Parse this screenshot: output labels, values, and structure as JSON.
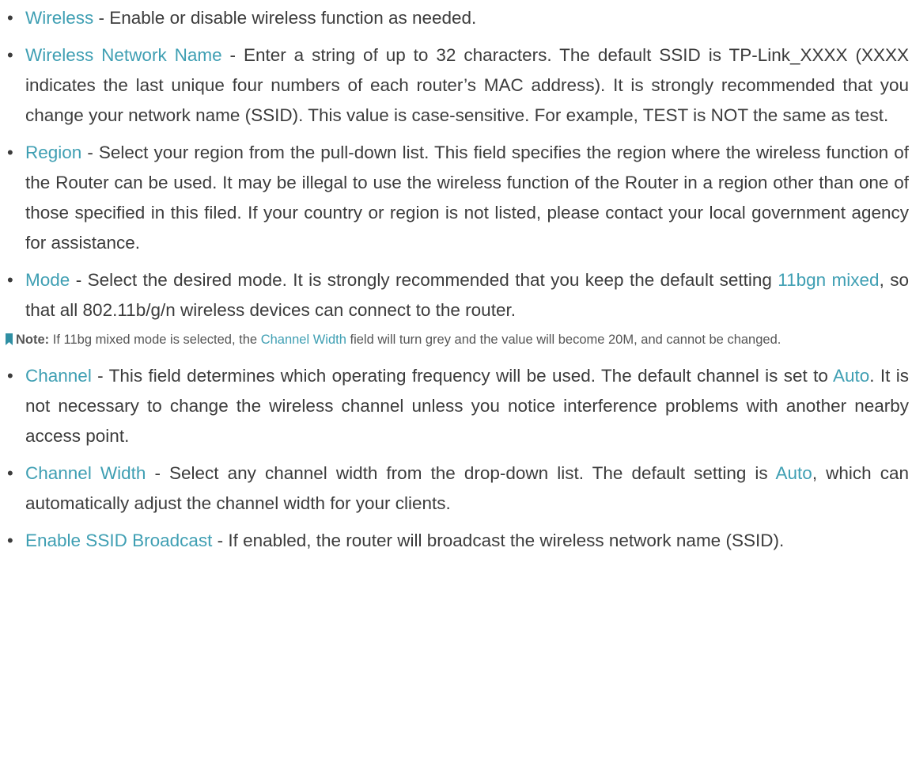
{
  "items_before_note": [
    {
      "term": "Wireless",
      "text": " - Enable or disable wireless function as needed."
    },
    {
      "term": "Wireless Network Name",
      "text": " - Enter a string of up to 32 characters. The default SSID is TP-Link_XXXX (XXXX indicates the last unique four numbers of each router’s MAC address). It is strongly recommended that you change your network name (SSID). This value is case-sensitive. For example, TEST is NOT the same as test."
    },
    {
      "term": "Region",
      "text": " - Select your region from the pull-down list. This field specifies the region where the wireless function of the Router can be used. It may be illegal to use the wireless function of the Router in a region other than one of those specified in this filed. If your country or region is not listed, please contact your local government agency for assistance."
    },
    {
      "term": "Mode",
      "text_a": " - Select the desired mode. It is strongly recommended that you keep the default setting ",
      "highlight": "11bgn mixed",
      "text_b": ", so that all 802.11b/g/n wireless devices can connect to the router."
    }
  ],
  "note": {
    "label": "Note:",
    "text_a": " If 11bg mixed mode is selected, the ",
    "highlight": "Channel Width",
    "text_b": " field will turn grey and the value will become 20M, and cannot be changed.",
    "icon": "note-flag-icon"
  },
  "items_after_note": [
    {
      "term": "Channel",
      "text_a": " - This field determines which operating frequency will be used. The default channel is set to ",
      "highlight": "Auto",
      "text_b": ". It is not necessary to change the wireless channel unless you notice interference problems with another nearby access point."
    },
    {
      "term": "Channel Width",
      "text_a": " - Select any channel width from the drop-down list. The default setting is ",
      "highlight": "Auto",
      "text_b": ", which can automatically adjust the channel width for your clients."
    },
    {
      "term": "Enable SSID Broadcast",
      "text": " - If enabled, the router will broadcast the wireless network name (SSID)."
    }
  ],
  "colors": {
    "accent": "#3f9fb3",
    "body_text": "#3c3c3c",
    "note_text": "#555555",
    "note_flag": "#2f8fa3"
  }
}
